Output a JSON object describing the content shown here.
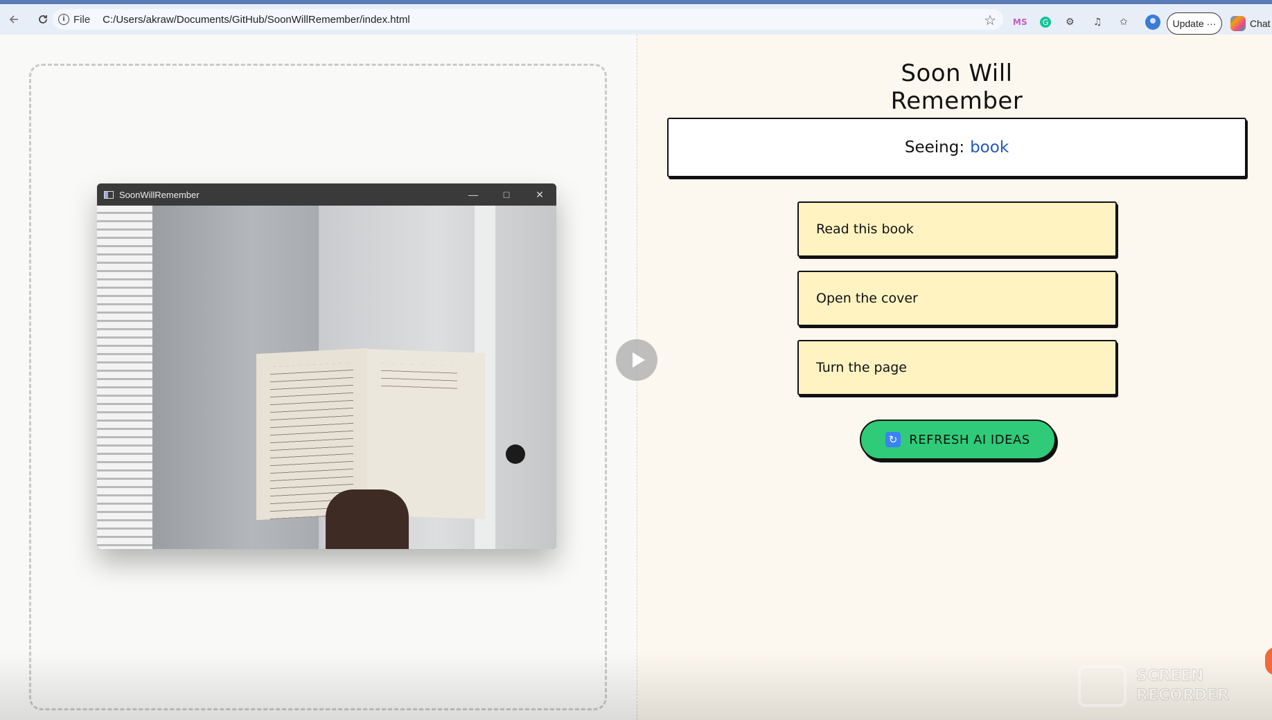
{
  "browser": {
    "file_label": "File",
    "url": "C:/Users/akraw/Documents/GitHub/SoonWillRemember/index.html",
    "update_label": "Update",
    "update_more": "···",
    "chat_label": "Chat",
    "ms_badge": "MS"
  },
  "app_window": {
    "title": "SoonWillRemember",
    "minimize": "—",
    "maximize": "□",
    "close": "✕"
  },
  "page": {
    "title": "Soon Will Remember",
    "seeing_label": "Seeing:",
    "seeing_value": "book",
    "ideas": [
      {
        "label": "Read this book"
      },
      {
        "label": "Open the cover"
      },
      {
        "label": "Turn the page"
      }
    ],
    "refresh_label": "REFRESH AI IDEAS",
    "refresh_icon": "🔄"
  },
  "watermark": {
    "line1": "SCREEN",
    "line2": "RECORDER"
  },
  "colors": {
    "accent_green": "#2fcb78",
    "card_yellow": "#fff3c2",
    "seeing_blue": "#2057c6",
    "page_bg": "#fdf8ef"
  }
}
